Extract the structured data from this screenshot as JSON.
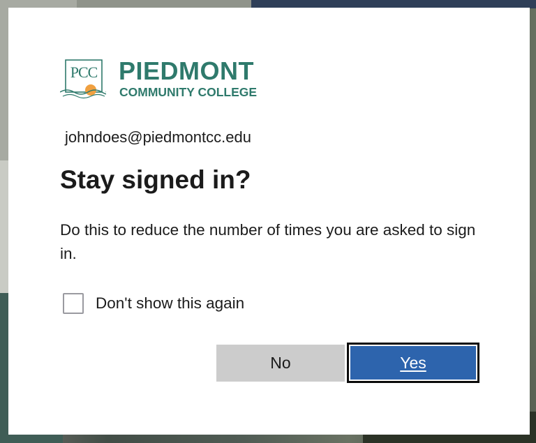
{
  "logo": {
    "mark_text": "PCC",
    "name_line1": "PIEDMONT",
    "name_line2": "COMMUNITY COLLEGE",
    "brand_color": "#2f7a6c",
    "sun_color": "#f0a040"
  },
  "account": {
    "email": "johndoes@piedmontcc.edu"
  },
  "dialog": {
    "title": "Stay signed in?",
    "description": "Do this to reduce the number of times you are asked to sign in.",
    "checkbox_label": "Don't show this again",
    "checkbox_checked": false
  },
  "buttons": {
    "no_label": "No",
    "yes_label": "Yes",
    "primary_color": "#2d64ad",
    "secondary_color": "#cccccc"
  }
}
